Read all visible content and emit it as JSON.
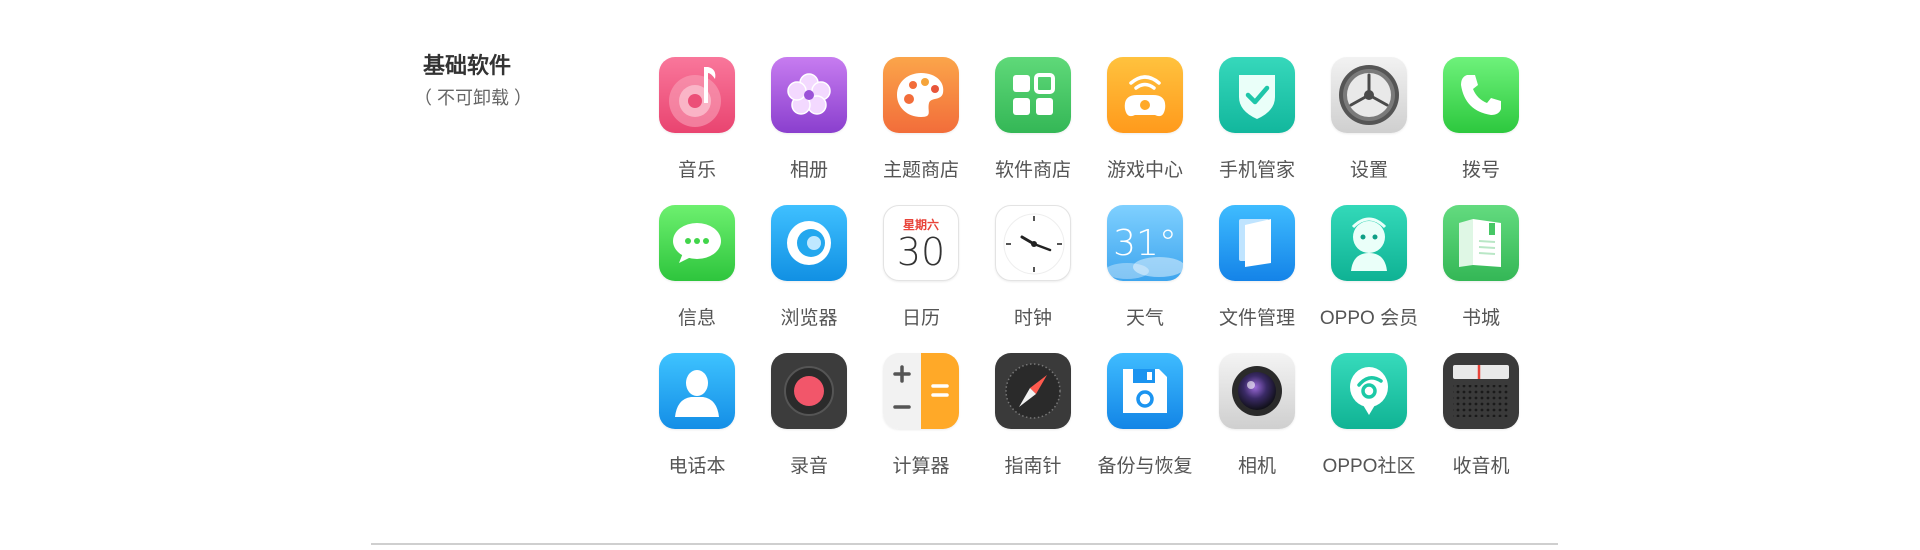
{
  "section": {
    "title": "基础软件",
    "subtitle": "（ 不可卸载 ）"
  },
  "apps": [
    {
      "label": "音乐",
      "icon": "music-icon"
    },
    {
      "label": "相册",
      "icon": "photo-album-icon"
    },
    {
      "label": "主题商店",
      "icon": "theme-store-icon"
    },
    {
      "label": "软件商店",
      "icon": "app-store-icon"
    },
    {
      "label": "游戏中心",
      "icon": "game-center-icon"
    },
    {
      "label": "手机管家",
      "icon": "phone-manager-icon"
    },
    {
      "label": "设置",
      "icon": "settings-icon"
    },
    {
      "label": "拨号",
      "icon": "phone-dialer-icon"
    },
    {
      "label": "信息",
      "icon": "messages-icon"
    },
    {
      "label": "浏览器",
      "icon": "browser-icon"
    },
    {
      "label": "日历",
      "icon": "calendar-icon"
    },
    {
      "label": "时钟",
      "icon": "clock-icon"
    },
    {
      "label": "天气",
      "icon": "weather-icon"
    },
    {
      "label": "文件管理",
      "icon": "file-manager-icon"
    },
    {
      "label": "OPPO 会员",
      "icon": "oppo-member-icon"
    },
    {
      "label": "书城",
      "icon": "bookstore-icon"
    },
    {
      "label": "电话本",
      "icon": "contacts-icon"
    },
    {
      "label": "录音",
      "icon": "recorder-icon"
    },
    {
      "label": "计算器",
      "icon": "calculator-icon"
    },
    {
      "label": "指南针",
      "icon": "compass-icon"
    },
    {
      "label": "备份与恢复",
      "icon": "backup-restore-icon"
    },
    {
      "label": "相机",
      "icon": "camera-icon"
    },
    {
      "label": "OPPO社区",
      "icon": "oppo-community-icon"
    },
    {
      "label": "收音机",
      "icon": "radio-icon"
    }
  ],
  "calendar": {
    "weekday": "星期六",
    "day": "30"
  },
  "weather": {
    "temp": "31°"
  },
  "colors": {
    "music": "#ec4f78",
    "album": "#9b52d8",
    "theme": "#f5803a",
    "appstore": "#3fc45e",
    "game": "#ffa928",
    "manager": "#1fc6a9",
    "dialer": "#3ed64e",
    "messages": "#41d54a",
    "browser": "#23a7ee",
    "weather": "#4fb7f2",
    "files": "#1a93f0",
    "member": "#19c6a6",
    "book": "#46c765",
    "contacts": "#1a9df0",
    "backup": "#1b94f0",
    "community": "#1cc9a6"
  }
}
